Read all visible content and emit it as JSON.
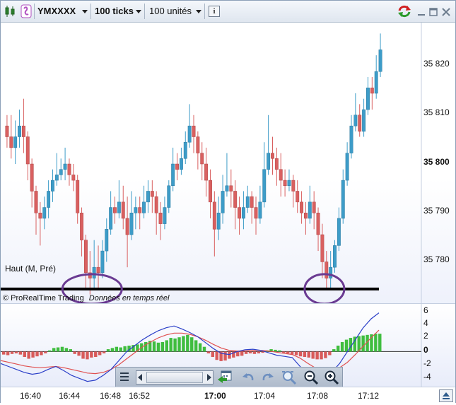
{
  "toolbar": {
    "symbol": "YMXXXX",
    "ticks": "100 ticks",
    "units": "100 unités",
    "info_icon": "info-icon",
    "chart_icon": "candlestick-icon",
    "wand_icon": "magic-wand-icon",
    "refresh_icon": "refresh-icon"
  },
  "chart": {
    "price_labels": [
      "35 820",
      "35 810",
      "35 800",
      "35 790",
      "35 780"
    ],
    "support_label": "Haut (M, Pré)",
    "footer_brand": "© ProRealTime Trading",
    "footer_status": "Données en temps réel",
    "colors": {
      "up": "#3d9cc8",
      "down": "#d96060",
      "line": "#000000",
      "circle": "#6a3a92"
    }
  },
  "indicator": {
    "labels": [
      "6",
      "4",
      "2",
      "0",
      "-2",
      "-4"
    ]
  },
  "time_axis": {
    "labels": [
      "16:40",
      "16:44",
      "16:48",
      "16:52",
      "17:00",
      "17:04",
      "17:08",
      "17:12"
    ]
  },
  "chart_data": {
    "type": "candlestick",
    "ylim": [
      35774,
      35826
    ],
    "support_level": 35777,
    "circled_lows": [
      "16:46",
      "17:08"
    ],
    "x_labels": [
      "16:40",
      "16:44",
      "16:48",
      "16:52",
      "17:00",
      "17:04",
      "17:08",
      "17:12"
    ],
    "candles": [
      {
        "o": 35807,
        "c": 35805,
        "h": 35809,
        "l": 35803
      },
      {
        "o": 35805,
        "c": 35803,
        "h": 35809,
        "l": 35801
      },
      {
        "o": 35803,
        "c": 35805,
        "h": 35808,
        "l": 35800
      },
      {
        "o": 35805,
        "c": 35807,
        "h": 35810,
        "l": 35803
      },
      {
        "o": 35807,
        "c": 35805,
        "h": 35812,
        "l": 35802
      },
      {
        "o": 35805,
        "c": 35800,
        "h": 35806,
        "l": 35797
      },
      {
        "o": 35800,
        "c": 35795,
        "h": 35801,
        "l": 35792
      },
      {
        "o": 35795,
        "c": 35791,
        "h": 35796,
        "l": 35787
      },
      {
        "o": 35791,
        "c": 35790,
        "h": 35793,
        "l": 35785
      },
      {
        "o": 35790,
        "c": 35792,
        "h": 35794,
        "l": 35788
      },
      {
        "o": 35792,
        "c": 35795,
        "h": 35797,
        "l": 35790
      },
      {
        "o": 35795,
        "c": 35797,
        "h": 35799,
        "l": 35793
      },
      {
        "o": 35797,
        "c": 35798,
        "h": 35802,
        "l": 35796
      },
      {
        "o": 35798,
        "c": 35799,
        "h": 35801,
        "l": 35797
      },
      {
        "o": 35799,
        "c": 35800,
        "h": 35803,
        "l": 35797
      },
      {
        "o": 35800,
        "c": 35798,
        "h": 35801,
        "l": 35796
      },
      {
        "o": 35798,
        "c": 35797,
        "h": 35800,
        "l": 35795
      },
      {
        "o": 35797,
        "c": 35791,
        "h": 35798,
        "l": 35789
      },
      {
        "o": 35791,
        "c": 35786,
        "h": 35792,
        "l": 35783
      },
      {
        "o": 35786,
        "c": 35780,
        "h": 35787,
        "l": 35777
      },
      {
        "o": 35780,
        "c": 35779,
        "h": 35784,
        "l": 35776
      },
      {
        "o": 35779,
        "c": 35781,
        "h": 35786,
        "l": 35777
      },
      {
        "o": 35781,
        "c": 35780,
        "h": 35785,
        "l": 35777
      },
      {
        "o": 35780,
        "c": 35784,
        "h": 35786,
        "l": 35779
      },
      {
        "o": 35784,
        "c": 35788,
        "h": 35790,
        "l": 35782
      },
      {
        "o": 35788,
        "c": 35792,
        "h": 35795,
        "l": 35787
      },
      {
        "o": 35792,
        "c": 35791,
        "h": 35794,
        "l": 35789
      },
      {
        "o": 35791,
        "c": 35793,
        "h": 35797,
        "l": 35790
      },
      {
        "o": 35793,
        "c": 35790,
        "h": 35796,
        "l": 35788
      },
      {
        "o": 35790,
        "c": 35787,
        "h": 35794,
        "l": 35781
      },
      {
        "o": 35787,
        "c": 35791,
        "h": 35795,
        "l": 35786
      },
      {
        "o": 35791,
        "c": 35792,
        "h": 35794,
        "l": 35788
      },
      {
        "o": 35792,
        "c": 35791,
        "h": 35794,
        "l": 35788
      },
      {
        "o": 35791,
        "c": 35793,
        "h": 35796,
        "l": 35790
      },
      {
        "o": 35793,
        "c": 35795,
        "h": 35797,
        "l": 35791
      },
      {
        "o": 35795,
        "c": 35794,
        "h": 35797,
        "l": 35791
      },
      {
        "o": 35794,
        "c": 35791,
        "h": 35795,
        "l": 35787
      },
      {
        "o": 35791,
        "c": 35789,
        "h": 35793,
        "l": 35786
      },
      {
        "o": 35789,
        "c": 35792,
        "h": 35794,
        "l": 35788
      },
      {
        "o": 35792,
        "c": 35796,
        "h": 35797,
        "l": 35791
      },
      {
        "o": 35796,
        "c": 35800,
        "h": 35803,
        "l": 35795
      },
      {
        "o": 35800,
        "c": 35799,
        "h": 35802,
        "l": 35797
      },
      {
        "o": 35799,
        "c": 35801,
        "h": 35803,
        "l": 35798
      },
      {
        "o": 35801,
        "c": 35804,
        "h": 35806,
        "l": 35800
      },
      {
        "o": 35804,
        "c": 35807,
        "h": 35811,
        "l": 35803
      },
      {
        "o": 35807,
        "c": 35805,
        "h": 35809,
        "l": 35802
      },
      {
        "o": 35805,
        "c": 35802,
        "h": 35806,
        "l": 35799
      },
      {
        "o": 35802,
        "c": 35800,
        "h": 35804,
        "l": 35797
      },
      {
        "o": 35800,
        "c": 35797,
        "h": 35803,
        "l": 35794
      },
      {
        "o": 35797,
        "c": 35793,
        "h": 35799,
        "l": 35790
      },
      {
        "o": 35793,
        "c": 35788,
        "h": 35795,
        "l": 35783
      },
      {
        "o": 35788,
        "c": 35791,
        "h": 35794,
        "l": 35786
      },
      {
        "o": 35791,
        "c": 35795,
        "h": 35798,
        "l": 35789
      },
      {
        "o": 35795,
        "c": 35796,
        "h": 35802,
        "l": 35794
      },
      {
        "o": 35796,
        "c": 35795,
        "h": 35799,
        "l": 35792
      },
      {
        "o": 35795,
        "c": 35792,
        "h": 35797,
        "l": 35788
      },
      {
        "o": 35792,
        "c": 35790,
        "h": 35794,
        "l": 35787
      },
      {
        "o": 35790,
        "c": 35792,
        "h": 35795,
        "l": 35788
      },
      {
        "o": 35792,
        "c": 35794,
        "h": 35796,
        "l": 35791
      },
      {
        "o": 35794,
        "c": 35792,
        "h": 35795,
        "l": 35789
      },
      {
        "o": 35792,
        "c": 35790,
        "h": 35794,
        "l": 35787
      },
      {
        "o": 35790,
        "c": 35793,
        "h": 35796,
        "l": 35789
      },
      {
        "o": 35793,
        "c": 35799,
        "h": 35804,
        "l": 35792
      },
      {
        "o": 35799,
        "c": 35802,
        "h": 35809,
        "l": 35798
      },
      {
        "o": 35802,
        "c": 35801,
        "h": 35805,
        "l": 35798
      },
      {
        "o": 35801,
        "c": 35799,
        "h": 35803,
        "l": 35796
      },
      {
        "o": 35799,
        "c": 35797,
        "h": 35802,
        "l": 35794
      },
      {
        "o": 35797,
        "c": 35796,
        "h": 35799,
        "l": 35794
      },
      {
        "o": 35796,
        "c": 35797,
        "h": 35799,
        "l": 35795
      },
      {
        "o": 35797,
        "c": 35795,
        "h": 35798,
        "l": 35792
      },
      {
        "o": 35795,
        "c": 35793,
        "h": 35797,
        "l": 35791
      },
      {
        "o": 35793,
        "c": 35791,
        "h": 35795,
        "l": 35789
      },
      {
        "o": 35791,
        "c": 35790,
        "h": 35793,
        "l": 35787
      },
      {
        "o": 35790,
        "c": 35793,
        "h": 35796,
        "l": 35789
      },
      {
        "o": 35793,
        "c": 35791,
        "h": 35795,
        "l": 35788
      },
      {
        "o": 35791,
        "c": 35787,
        "h": 35792,
        "l": 35784
      },
      {
        "o": 35787,
        "c": 35782,
        "h": 35789,
        "l": 35779
      },
      {
        "o": 35782,
        "c": 35779,
        "h": 35784,
        "l": 35777
      },
      {
        "o": 35779,
        "c": 35781,
        "h": 35784,
        "l": 35777
      },
      {
        "o": 35781,
        "c": 35785,
        "h": 35786,
        "l": 35780
      },
      {
        "o": 35785,
        "c": 35790,
        "h": 35792,
        "l": 35784
      },
      {
        "o": 35790,
        "c": 35797,
        "h": 35799,
        "l": 35789
      },
      {
        "o": 35797,
        "c": 35802,
        "h": 35804,
        "l": 35796
      },
      {
        "o": 35802,
        "c": 35807,
        "h": 35809,
        "l": 35801
      },
      {
        "o": 35807,
        "c": 35809,
        "h": 35813,
        "l": 35806
      },
      {
        "o": 35809,
        "c": 35806,
        "h": 35811,
        "l": 35805
      },
      {
        "o": 35806,
        "c": 35810,
        "h": 35812,
        "l": 35805
      },
      {
        "o": 35810,
        "c": 35814,
        "h": 35816,
        "l": 35809
      },
      {
        "o": 35814,
        "c": 35813,
        "h": 35816,
        "l": 35810
      },
      {
        "o": 35813,
        "c": 35817,
        "h": 35820,
        "l": 35812
      },
      {
        "o": 35817,
        "c": 35821,
        "h": 35824,
        "l": 35816
      }
    ],
    "indicator": {
      "ylim": [
        -6,
        8
      ],
      "histogram": [
        -0.5,
        -0.6,
        -0.4,
        -0.3,
        -0.5,
        -0.9,
        -1.2,
        -1.0,
        -0.8,
        -0.6,
        -0.3,
        0.2,
        0.6,
        0.7,
        0.8,
        0.6,
        0.4,
        -0.4,
        -0.7,
        -1.2,
        -1.3,
        -1.0,
        -0.9,
        -0.6,
        -0.3,
        0.4,
        0.6,
        0.8,
        0.7,
        0.9,
        1.0,
        1.1,
        1.2,
        1.4,
        1.6,
        1.8,
        1.7,
        1.5,
        1.6,
        1.9,
        2.3,
        2.2,
        2.4,
        2.6,
        2.8,
        2.4,
        1.9,
        1.4,
        0.8,
        -0.3,
        -0.9,
        -1.4,
        -1.6,
        -1.5,
        -1.2,
        -1.0,
        -0.8,
        -0.7,
        -0.4,
        -0.3,
        -0.4,
        -0.3,
        -0.2,
        0.2,
        0.4,
        0.3,
        0.2,
        -0.2,
        -0.3,
        -0.5,
        -0.6,
        -0.8,
        -0.9,
        -1.0,
        -1.2,
        -1.3,
        -1.3,
        -1.1,
        -0.6,
        0.4,
        1.0,
        1.6,
        2.0,
        2.3,
        2.5,
        2.6,
        2.7,
        2.8,
        2.9,
        3.0,
        3.0
      ],
      "fast_line": [
        -2.0,
        -2.5,
        -3.0,
        -3.5,
        -3.8,
        -3.6,
        -3.0,
        -2.5,
        -3.2,
        -4.0,
        -4.5,
        -5.0,
        -4.8,
        -4.0,
        -3.0,
        -1.5,
        0.0,
        1.0,
        2.0,
        2.8,
        3.5,
        4.0,
        4.3,
        3.8,
        3.2,
        2.5,
        1.5,
        0.5,
        -0.3,
        -0.5,
        0.0,
        0.3,
        0.4,
        0.2,
        -0.2,
        -0.6,
        -0.8,
        -1.0,
        -2.5,
        -4.0,
        -4.8,
        -4.5,
        -3.5,
        -2.0,
        0.0,
        2.0,
        4.0,
        5.5,
        6.5
      ],
      "slow_line": [
        -1.5,
        -1.8,
        -2.1,
        -2.4,
        -2.6,
        -2.7,
        -2.6,
        -2.5,
        -2.7,
        -3.0,
        -3.3,
        -3.6,
        -3.7,
        -3.5,
        -3.0,
        -2.2,
        -1.2,
        -0.2,
        0.8,
        1.6,
        2.3,
        2.8,
        3.1,
        3.1,
        2.9,
        2.5,
        1.9,
        1.2,
        0.6,
        0.2,
        0.1,
        0.1,
        0.2,
        0.2,
        0.1,
        -0.1,
        -0.3,
        -0.5,
        -1.1,
        -2.0,
        -2.8,
        -3.2,
        -3.2,
        -2.7,
        -1.8,
        -0.5,
        0.9,
        2.3,
        3.6
      ]
    }
  }
}
